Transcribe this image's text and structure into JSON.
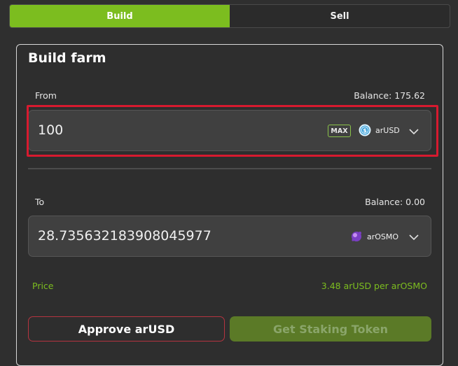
{
  "tabs": [
    {
      "label": "Build",
      "active": true
    },
    {
      "label": "Sell",
      "active": false
    }
  ],
  "card": {
    "title": "Build farm",
    "from": {
      "label": "From",
      "balance": "Balance: 175.62",
      "value": "100",
      "max_label": "MAX",
      "token": "arUSD",
      "token_icon": "arusd-coin-icon"
    },
    "to": {
      "label": "To",
      "balance": "Balance: 0.00",
      "value": "28.735632183908045977",
      "token": "arOSMO",
      "token_icon": "arosmo-coin-icon"
    },
    "price": {
      "label": "Price",
      "value": "3.48 arUSD per arOSMO"
    },
    "buttons": {
      "approve": "Approve arUSD",
      "staking": "Get Staking Token"
    }
  },
  "colors": {
    "accent": "#7cbd1f",
    "highlight": "#d71a2f",
    "background": "#2f2f2f"
  }
}
